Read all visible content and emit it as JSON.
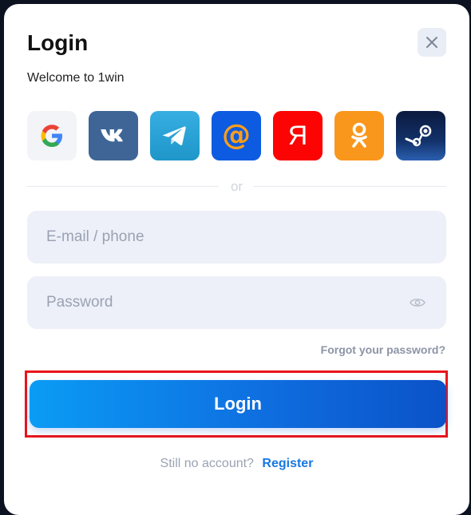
{
  "modal": {
    "title": "Login",
    "subtitle": "Welcome to 1win"
  },
  "close_icon": "close-icon",
  "social_logins": [
    {
      "name": "google",
      "icon": "google-icon",
      "bg": "#f2f4f8"
    },
    {
      "name": "vk",
      "icon": "vk-icon",
      "bg": "#3e6596"
    },
    {
      "name": "telegram",
      "icon": "telegram-icon",
      "bg": "#279fd8"
    },
    {
      "name": "mail",
      "icon": "mail-at-icon",
      "bg": "#0d5be0",
      "glyph": "@",
      "glyph_color": "#ff9e1a"
    },
    {
      "name": "yandex",
      "icon": "yandex-icon",
      "bg": "#fc0404",
      "glyph": "Я",
      "glyph_color": "#ffffff"
    },
    {
      "name": "odnoklassniki",
      "icon": "odnoklassniki-icon",
      "bg": "#f9961c"
    },
    {
      "name": "steam",
      "icon": "steam-icon",
      "bg": "#0b1c45"
    }
  ],
  "divider": {
    "text": "or"
  },
  "form": {
    "email_placeholder": "E-mail / phone",
    "email_value": "",
    "password_placeholder": "Password",
    "password_value": "",
    "forgot_password": "Forgot your password?",
    "login_button": "Login"
  },
  "footer": {
    "question": "Still no account?",
    "register_link": "Register"
  },
  "colors": {
    "accent": "#1878e0",
    "button_gradient_start": "#0a9cf5",
    "button_gradient_end": "#0b52c8",
    "highlight": "#e8141b"
  }
}
